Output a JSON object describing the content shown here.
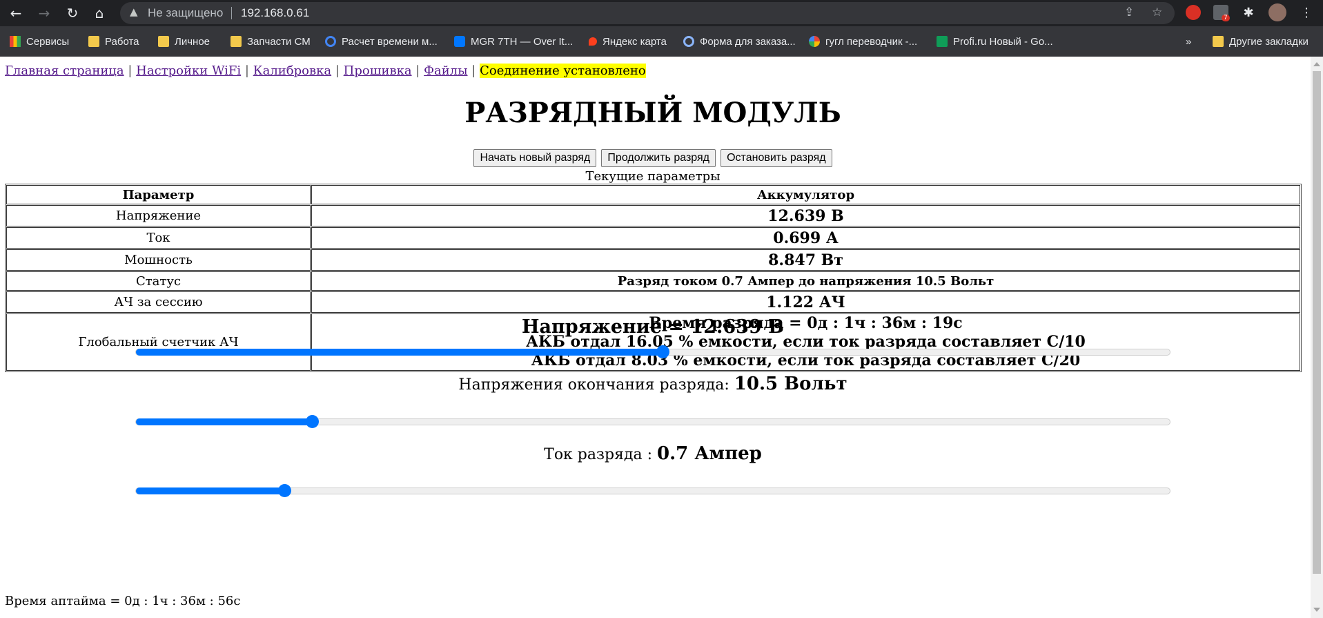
{
  "browser": {
    "security_status": "Не защищено",
    "url": "192.168.0.61",
    "ext_badge": "7",
    "bookmarks": [
      {
        "label": "Сервисы",
        "icon": "apps-grid-icon"
      },
      {
        "label": "Работа",
        "icon": "folder-icon"
      },
      {
        "label": "Личное",
        "icon": "folder-icon"
      },
      {
        "label": "Запчасти СМ",
        "icon": "folder-icon"
      },
      {
        "label": "Расчет времени м...",
        "icon": "site-favicon"
      },
      {
        "label": "MGR 7TH — Over It...",
        "icon": "vk-icon"
      },
      {
        "label": "Яндекс карта",
        "icon": "map-pin-icon"
      },
      {
        "label": "Форма для заказа...",
        "icon": "site-favicon"
      },
      {
        "label": "гугл переводчик -...",
        "icon": "google-icon"
      },
      {
        "label": "Profi.ru Новый - Go...",
        "icon": "sheets-icon"
      }
    ],
    "more": "»",
    "other_bookmarks": "Другие закладки"
  },
  "nav": {
    "links": [
      "Главная страница",
      "Настройки WiFi",
      "Калибровка",
      "Прошивка",
      "Файлы"
    ],
    "separator": "|",
    "connection": "Соединение установлено"
  },
  "title": "РАЗРЯДНЫЙ МОДУЛЬ",
  "buttons": {
    "start": "Начать новый разряд",
    "resume": "Продолжить разряд",
    "stop": "Остановить разряд"
  },
  "table": {
    "caption": "Текущие параметры",
    "headers": [
      "Параметр",
      "Аккумулятор"
    ],
    "rows": [
      {
        "name": "Напряжение",
        "value": "12.639 В"
      },
      {
        "name": "Ток",
        "value": "0.699 А"
      },
      {
        "name": "Мошность",
        "value": "8.847 Вт"
      },
      {
        "name": "Статус",
        "value": "Разряд током 0.7 Ампер до напряжения 10.5 Вольт"
      },
      {
        "name": "АЧ за сессию",
        "value": "1.122 АЧ"
      },
      {
        "name": "Глобальный счетчик АЧ",
        "lines": [
          "Время разряда = 0д : 1ч : 36м : 19с",
          "АКБ отдал 16.05 % емкости, если ток разряда составляет C/10",
          "АКБ отдал 8.03 % емкости, если ток разряда составляет C/20"
        ]
      }
    ]
  },
  "voltage": {
    "label": "Напряжение = 12.639 В",
    "slider_fraction": 0.51
  },
  "end_voltage": {
    "label": "Напряжения окончания разряда: ",
    "value": "10.5 Вольт",
    "slider_fraction": 0.171
  },
  "current": {
    "label": "Ток разряда : ",
    "value": "0.7 Ампер",
    "slider_fraction": 0.144
  },
  "uptime": "Время аптайма = 0д : 1ч : 36м : 56с",
  "colors": {
    "accent": "#0075ff",
    "highlight": "#ffff00",
    "link": "#551a8b"
  }
}
